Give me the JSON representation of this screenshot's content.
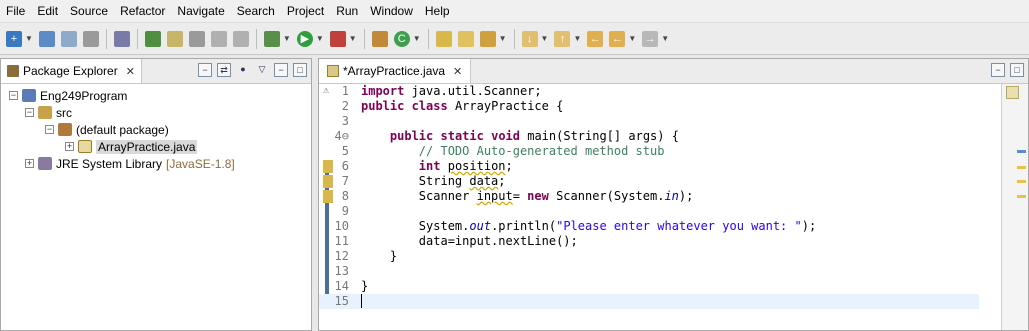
{
  "menu": [
    "File",
    "Edit",
    "Source",
    "Refactor",
    "Navigate",
    "Search",
    "Project",
    "Run",
    "Window",
    "Help"
  ],
  "colors": {
    "keyword": "#7f0055",
    "comment": "#3f7f5f",
    "string": "#2a00ff",
    "field": "#0000c0",
    "library_suffix": "#8a6d3b",
    "selection_bg": "#d9d9d9"
  },
  "package_explorer": {
    "tab_label": "Package Explorer",
    "tree": [
      {
        "label": "Eng249Program",
        "icon": "java-project-icon",
        "expander": "−"
      },
      {
        "label": "src",
        "icon": "source-folder-icon",
        "expander": "−"
      },
      {
        "label": "(default package)",
        "icon": "package-icon",
        "expander": "−"
      },
      {
        "label": "ArrayPractice.java",
        "icon": "java-file-icon",
        "expander": "+",
        "selected": true
      },
      {
        "label": "JRE System Library",
        "suffix": "[JavaSE-1.8]",
        "icon": "library-icon",
        "expander": "+"
      }
    ]
  },
  "editor": {
    "tab_label": "*ArrayPractice.java",
    "code_lines": [
      {
        "n": "1",
        "text": "import java.util.Scanner;"
      },
      {
        "n": "2",
        "text": "public class ArrayPractice {"
      },
      {
        "n": "3",
        "text": ""
      },
      {
        "n": "4⊖",
        "text": "    public static void main(String[] args) {"
      },
      {
        "n": "5",
        "text": "        // TODO Auto-generated method stub"
      },
      {
        "n": "6",
        "text": "        int position;"
      },
      {
        "n": "7",
        "text": "        String data;"
      },
      {
        "n": "8",
        "text": "        Scanner input= new Scanner(System.in);"
      },
      {
        "n": "9",
        "text": ""
      },
      {
        "n": "10",
        "text": "        System.out.println(\"Please enter whatever you want: \");"
      },
      {
        "n": "11",
        "text": "        data=input.nextLine();"
      },
      {
        "n": "12",
        "text": "    }"
      },
      {
        "n": "13",
        "text": ""
      },
      {
        "n": "14",
        "text": "}"
      },
      {
        "n": "15",
        "text": ""
      }
    ],
    "tokens": {
      "l1_import": "import",
      "l1_rest": " java.util.Scanner;",
      "l2_public": "public",
      "l2_class": "class",
      "l2_rest": " ArrayPractice {",
      "l4_public": "public",
      "l4_static": "static",
      "l4_void": "void",
      "l4_rest": " main(String[] args) {",
      "l5_comment": "// TODO Auto-generated method stub",
      "l6_int": "int",
      "l6_var": "position",
      "l6_semi": ";",
      "l7_type": "String ",
      "l7_var": "data",
      "l7_semi": ";",
      "l8_type": "Scanner ",
      "l8_var": "input",
      "l8_eq": "= ",
      "l8_new": "new",
      "l8_mid": " Scanner(System.",
      "l8_in": "in",
      "l8_end": ");",
      "l10_a": "System.",
      "l10_out": "out",
      "l10_b": ".println(",
      "l10_str": "\"Please enter whatever you want: \"",
      "l10_c": ");",
      "l11": "data=input.nextLine();",
      "l12": "}",
      "l14": "}"
    }
  }
}
